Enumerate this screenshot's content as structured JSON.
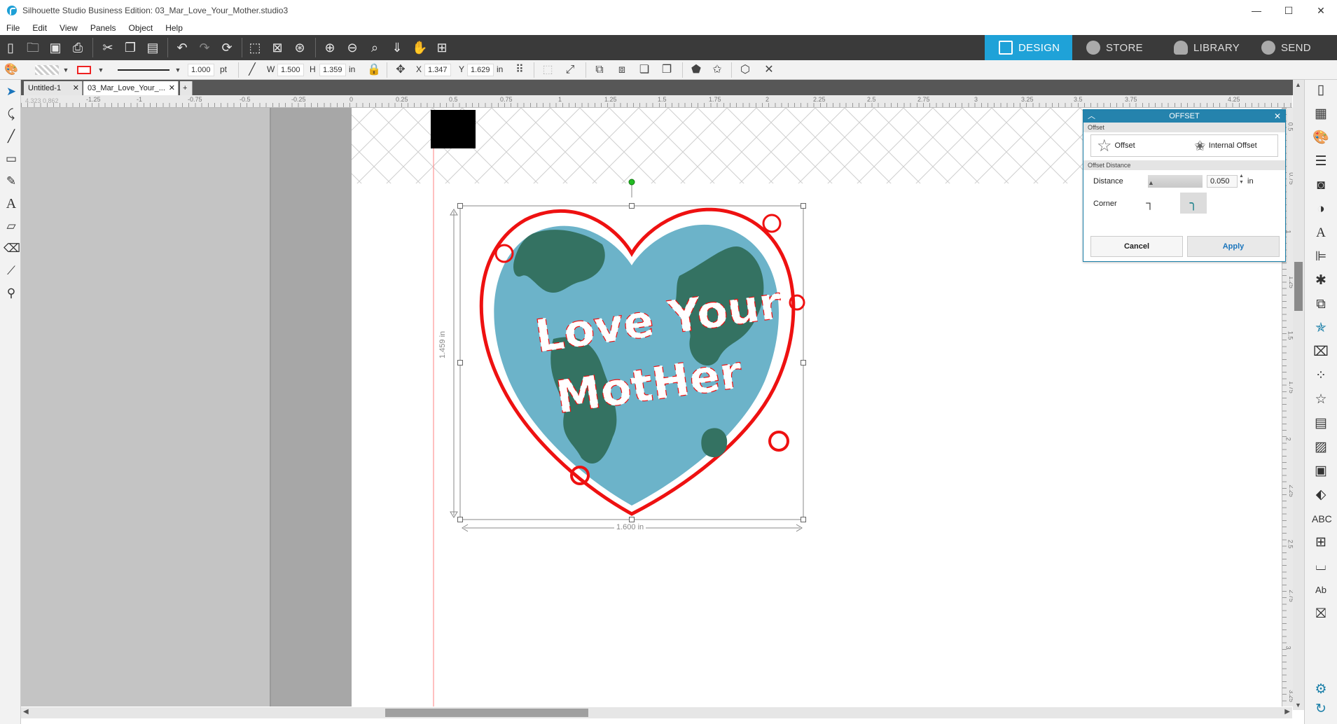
{
  "window": {
    "title": "Silhouette Studio Business Edition: 03_Mar_Love_Your_Mother.studio3",
    "minimize": "—",
    "maximize": "☐",
    "close": "✕"
  },
  "menu": [
    "File",
    "Edit",
    "View",
    "Panels",
    "Object",
    "Help"
  ],
  "nav_tabs": {
    "design": "DESIGN",
    "store": "STORE",
    "library": "LIBRARY",
    "send": "SEND"
  },
  "properties": {
    "line_weight": "1.000",
    "line_unit": "pt",
    "w_label": "W",
    "w_value": "1.500",
    "h_label": "H",
    "h_value": "1.359",
    "size_unit": "in",
    "x_label": "X",
    "x_value": "1.347",
    "y_label": "Y",
    "y_value": "1.629",
    "pos_unit": "in"
  },
  "doc_tabs": [
    {
      "label": "Untitled-1",
      "close": "✕"
    },
    {
      "label": "03_Mar_Love_Your_...",
      "close": "✕"
    }
  ],
  "add_tab": "+",
  "rulers": {
    "top": [
      "-1.25",
      "-1",
      "-0.75",
      "-0.5",
      "-0.25",
      "0",
      "0.25",
      "0.5",
      "0.75",
      "1",
      "1.25",
      "1.5",
      "1.75",
      "2",
      "2.25",
      "2.5",
      "2.75",
      "3",
      "3.25",
      "3.5",
      "3.75",
      "4.25"
    ],
    "left": [
      "0.5",
      "0.75",
      "1",
      "1.25",
      "1.5",
      "1.75",
      "2",
      "2.25",
      "2.5",
      "2.75",
      "3",
      "3.25"
    ],
    "corner": "4.323  0.862"
  },
  "design": {
    "line1": "Love Your",
    "line2": "MotHer",
    "width_dim": "1.600 in",
    "height_dim": "1.459 in"
  },
  "offset_panel": {
    "title": "OFFSET",
    "section_offset": "Offset",
    "offset_label": "Offset",
    "internal_offset_label": "Internal Offset",
    "section_distance": "Offset Distance",
    "distance_label": "Distance",
    "distance_value": "0.050",
    "distance_unit": "in",
    "corner_label": "Corner",
    "cancel": "Cancel",
    "apply": "Apply"
  },
  "colors": {
    "accent": "#1fa2d8",
    "offset_line": "#ee1111",
    "earth_water": "#6cb3c9",
    "earth_land": "#347262"
  }
}
